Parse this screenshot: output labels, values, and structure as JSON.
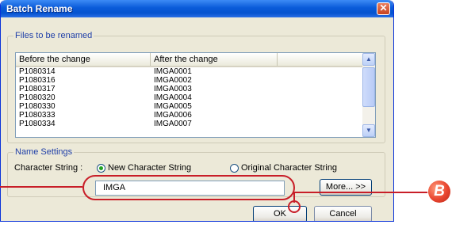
{
  "window": {
    "title": "Batch Rename"
  },
  "files_group": {
    "legend": "Files to be renamed",
    "columns": [
      "Before the change",
      "After the change"
    ],
    "rows": [
      {
        "before": "P1080314",
        "after": "IMGA0001"
      },
      {
        "before": "P1080316",
        "after": "IMGA0002"
      },
      {
        "before": "P1080317",
        "after": "IMGA0003"
      },
      {
        "before": "P1080320",
        "after": "IMGA0004"
      },
      {
        "before": "P1080330",
        "after": "IMGA0005"
      },
      {
        "before": "P1080333",
        "after": "IMGA0006"
      },
      {
        "before": "P1080334",
        "after": "IMGA0007"
      }
    ]
  },
  "name_settings": {
    "legend": "Name Settings",
    "character_string_label": "Character String :",
    "option_new": "New Character String",
    "option_original": "Original Character String",
    "selected_option": "new",
    "input_value": "IMGA",
    "more_button": "More... >>"
  },
  "buttons": {
    "ok": "OK",
    "cancel": "Cancel"
  },
  "callout": {
    "badge": "B",
    "color": "#c81e28"
  },
  "icons": {
    "close": "close-icon",
    "scroll_up": "chevron-up-icon",
    "scroll_down": "chevron-down-icon"
  }
}
